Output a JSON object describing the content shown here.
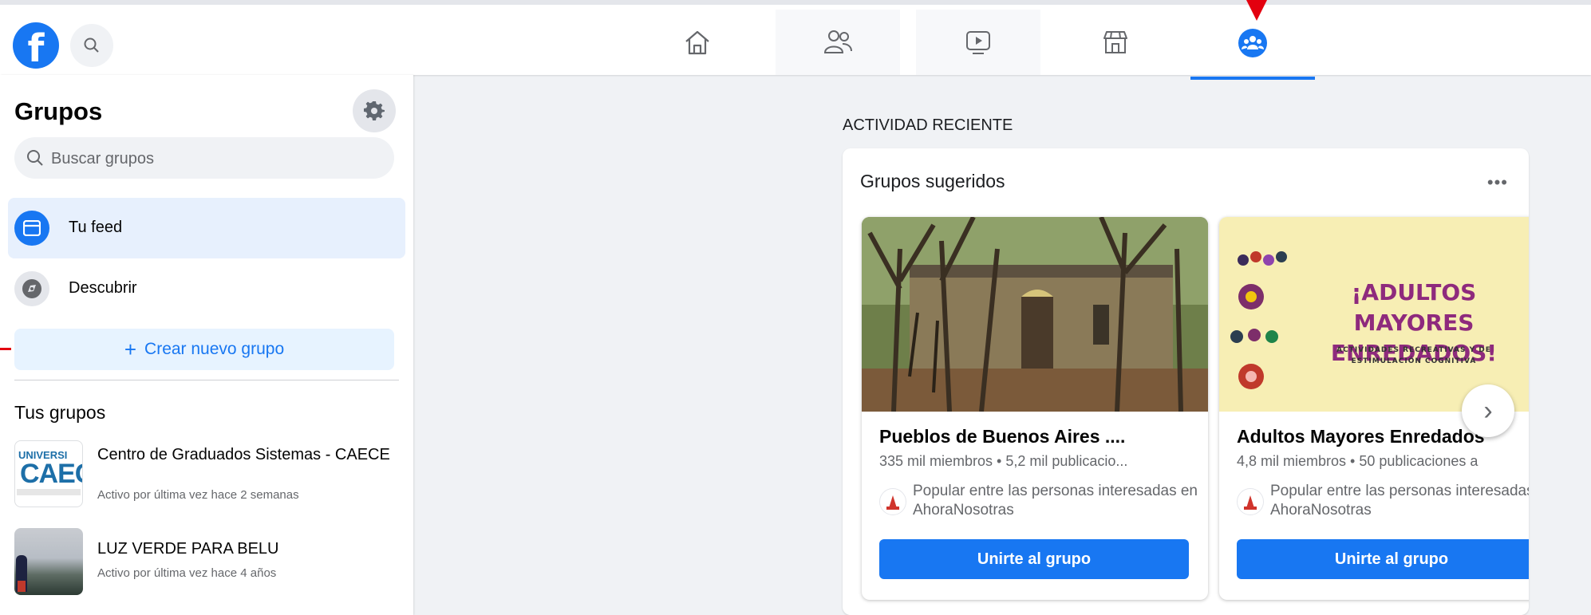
{
  "topbar": {
    "logo_letter": "f",
    "nav": [
      "home-icon",
      "friends-icon",
      "watch-icon",
      "marketplace-icon",
      "groups-icon"
    ]
  },
  "sidebar": {
    "title": "Grupos",
    "search_placeholder": "Buscar grupos",
    "items": [
      {
        "label": "Tu feed",
        "icon": "feed-icon"
      },
      {
        "label": "Descubrir",
        "icon": "discover-icon"
      }
    ],
    "create_label": "Crear nuevo grupo",
    "your_groups_title": "Tus grupos",
    "groups": [
      {
        "name": "Centro de Graduados Sistemas - CAECE",
        "activity": "Activo por última vez hace 2 semanas",
        "thumb_text": "UNIVERSI CAEC"
      },
      {
        "name": "LUZ VERDE PARA BELU",
        "activity": "Activo por última vez hace 4 años"
      }
    ]
  },
  "main": {
    "section_label": "ACTIVIDAD RECIENTE",
    "card_title": "Grupos sugeridos",
    "more_label": "•••",
    "suggestions": [
      {
        "name": "Pueblos de Buenos Aires ....",
        "meta": "335 mil miembros • 5,2 mil publicacio...",
        "popular": "Popular entre las personas interesadas en AhoraNosotras",
        "join_label": "Unirte al grupo"
      },
      {
        "name": "Adultos Mayores Enredados",
        "meta": "4,8 mil miembros • 50 publicaciones a",
        "popular": "Popular entre las personas interesadas en AhoraNosotras",
        "join_label": "Unirte al grupo",
        "banner_title": "¡ADULTOS MAYORES ENREDADOS!",
        "banner_subtitle": "ACTIVIDADES RECREATIVAS Y DE ESTIMULACIÓN COGNITIVA"
      }
    ],
    "next_label": "›"
  },
  "colors": {
    "accent": "#1877f2",
    "annotation": "#e3000f"
  }
}
